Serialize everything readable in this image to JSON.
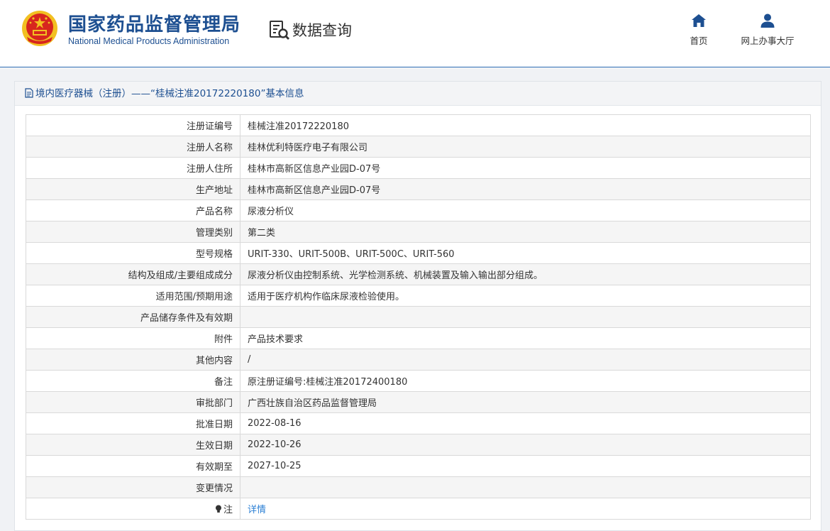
{
  "header": {
    "brand_cn": "国家药品监督管理局",
    "brand_en": "National Medical Products Administration",
    "query_title": "数据查询",
    "nav": [
      {
        "label": "首页",
        "icon": "home-icon"
      },
      {
        "label": "网上办事大厅",
        "icon": "user-icon"
      }
    ]
  },
  "panel": {
    "title": "境内医疗器械（注册）——“桂械注准20172220180”基本信息",
    "rows": [
      {
        "key": "注册证编号",
        "value": "桂械注准20172220180"
      },
      {
        "key": "注册人名称",
        "value": "桂林优利特医疗电子有限公司"
      },
      {
        "key": "注册人住所",
        "value": "桂林市高新区信息产业园D-07号"
      },
      {
        "key": "生产地址",
        "value": "桂林市高新区信息产业园D-07号"
      },
      {
        "key": "产品名称",
        "value": "尿液分析仪"
      },
      {
        "key": "管理类别",
        "value": "第二类"
      },
      {
        "key": "型号规格",
        "value": "URIT-330、URIT-500B、URIT-500C、URIT-560"
      },
      {
        "key": "结构及组成/主要组成成分",
        "value": "尿液分析仪由控制系统、光学检测系统、机械装置及输入输出部分组成。"
      },
      {
        "key": "适用范围/预期用途",
        "value": "适用于医疗机构作临床尿液检验使用。"
      },
      {
        "key": "产品储存条件及有效期",
        "value": ""
      },
      {
        "key": "附件",
        "value": "产品技术要求"
      },
      {
        "key": "其他内容",
        "value": "/"
      },
      {
        "key": "备注",
        "value": "原注册证编号:桂械注准20172400180"
      },
      {
        "key": "审批部门",
        "value": "广西壮族自治区药品监督管理局"
      },
      {
        "key": "批准日期",
        "value": "2022-08-16"
      },
      {
        "key": "生效日期",
        "value": "2022-10-26"
      },
      {
        "key": "有效期至",
        "value": "2027-10-25"
      },
      {
        "key": "变更情况",
        "value": ""
      }
    ],
    "note": {
      "key": "注",
      "link": "详情"
    }
  },
  "colors": {
    "brand": "#1d4f91",
    "link": "#2b7fd4",
    "emblem_red": "#d7261e",
    "emblem_gold": "#f2c021"
  }
}
